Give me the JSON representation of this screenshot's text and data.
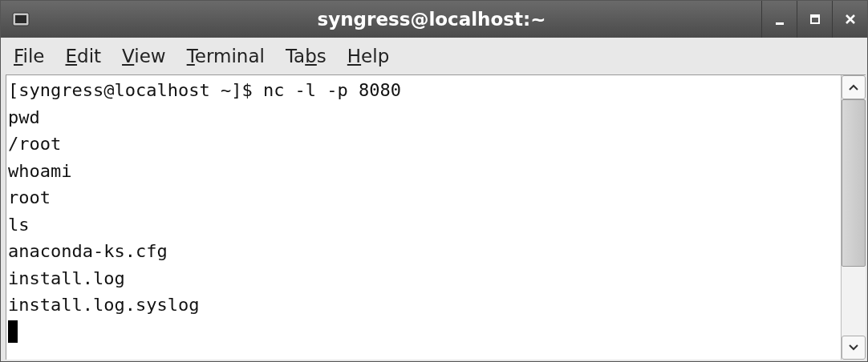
{
  "window": {
    "title": "syngress@localhost:~"
  },
  "menu": [
    {
      "accel": "F",
      "post": "ile"
    },
    {
      "accel": "E",
      "post": "dit"
    },
    {
      "accel": "V",
      "post": "iew"
    },
    {
      "accel": "T",
      "post": "erminal"
    },
    {
      "pre": "Ta",
      "accel": "b",
      "post": "s"
    },
    {
      "accel": "H",
      "post": "elp"
    }
  ],
  "terminal": {
    "lines": [
      "[syngress@localhost ~]$ nc -l -p 8080",
      "pwd",
      "/root",
      "whoami",
      "root",
      "ls",
      "anaconda-ks.cfg",
      "install.log",
      "install.log.syslog"
    ],
    "cursor": true
  }
}
